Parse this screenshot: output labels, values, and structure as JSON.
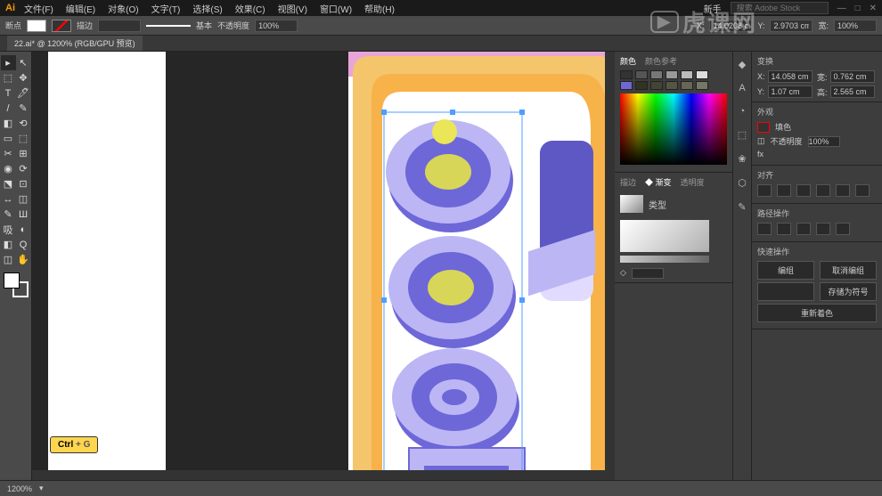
{
  "app": {
    "logo": "Ai"
  },
  "menu": [
    "文件(F)",
    "编辑(E)",
    "对象(O)",
    "文字(T)",
    "选择(S)",
    "效果(C)",
    "视图(V)",
    "窗口(W)",
    "帮助(H)"
  ],
  "topRight": {
    "workspace": "新手",
    "searchPlaceholder": "搜索 Adobe Stock"
  },
  "ctrl": {
    "toolMode": "断点",
    "strokeLabel": "描边",
    "strokeWidth": "",
    "styleLabel": "基本",
    "opacityLabel": "不透明度",
    "opacity": "100%",
    "x": "14.0208 cm",
    "y": "2.9703 cm",
    "w": "100%"
  },
  "tab": {
    "name": "22.ai* @ 1200% (RGB/GPU 预览)"
  },
  "tools": [
    [
      "▸",
      "↖"
    ],
    [
      "⬚",
      "✥"
    ],
    [
      "T",
      "🖊"
    ],
    [
      "/",
      "✎"
    ],
    [
      "◧",
      "⟲"
    ],
    [
      "▭",
      "⬚"
    ],
    [
      "✂",
      "⊞"
    ],
    [
      "◉",
      "⟳"
    ],
    [
      "⬔",
      "⊡"
    ],
    [
      "↔",
      "◫"
    ],
    [
      "✎",
      "Ш"
    ],
    [
      "吸",
      "◐"
    ],
    [
      "◧",
      "Q"
    ],
    [
      "◫",
      "✋"
    ]
  ],
  "colorPanel": {
    "tabs": [
      "颜色",
      "颜色参考"
    ]
  },
  "gradientPanel": {
    "tabs": [
      "描边",
      "◆ 渐变",
      "透明度"
    ],
    "typeLabel": "类型",
    "opacityField": ""
  },
  "rightIcons": [
    "◆",
    "A",
    "◔",
    "⬚",
    "❀",
    "⬡",
    "✎"
  ],
  "transform": {
    "title": "变换",
    "xLabel": "X:",
    "x": "14.058 cm",
    "yLabel": "Y:",
    "y": "1.07 cm",
    "wLabel": "宽:",
    "w": "0.762 cm",
    "hLabel": "高:",
    "h": "2.565 cm"
  },
  "appearance": {
    "title": "外观",
    "fillLabel": "填色",
    "opacityLabel": "不透明度",
    "opacity": "100%",
    "fxLabel": "fx"
  },
  "align": {
    "title": "对齐"
  },
  "quickActions": {
    "title": "路径操作",
    "icons": 5,
    "sectionTitle": "快速操作",
    "btn1": "编组",
    "btn2": "取消编组",
    "btn3": "",
    "btn4": "存储为符号",
    "btn5": "重新着色"
  },
  "status": {
    "zoom": "1200%"
  },
  "hint": {
    "key": "Ctrl",
    "plus": "+ G"
  },
  "watermark": "虎课网"
}
